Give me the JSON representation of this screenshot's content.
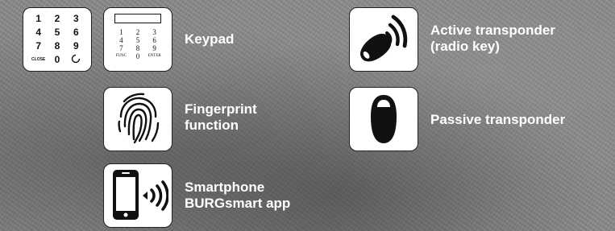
{
  "features": {
    "keypad": {
      "label": "Keypad",
      "round_keys": [
        "1",
        "2",
        "3",
        "4",
        "5",
        "6",
        "7",
        "8",
        "9",
        "CLOSE",
        "0",
        ""
      ],
      "display_keys": [
        "1",
        "2",
        "3",
        "4",
        "5",
        "6",
        "7",
        "8",
        "9",
        "FUNC",
        "0",
        "ENTER"
      ]
    },
    "fingerprint": {
      "label": "Fingerprint\nfunction",
      "icon": "fingerprint-icon"
    },
    "smartphone": {
      "label": "Smartphone\nBURGsmart app",
      "icon": "smartphone-signal-icon"
    },
    "active_transponder": {
      "label": "Active transponder\n(radio key)",
      "icon": "radio-key-icon"
    },
    "passive_transponder": {
      "label": "Passive transponder",
      "icon": "passive-transponder-icon"
    }
  },
  "colors": {
    "label_text": "#ffffff",
    "icon_box": "#ffffff",
    "icon_ink": "#111111"
  }
}
